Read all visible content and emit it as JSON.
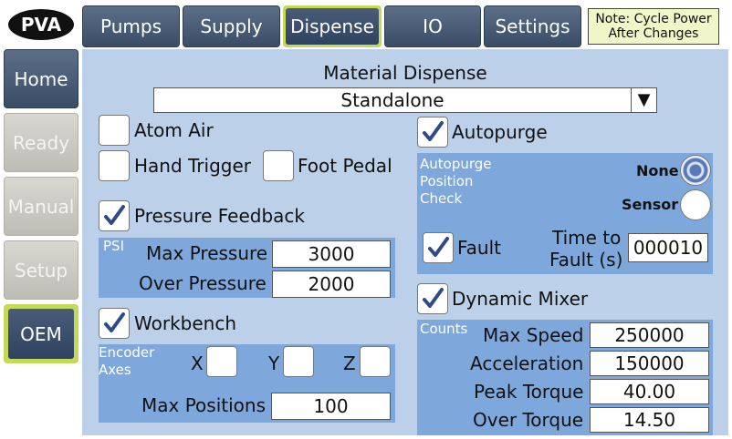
{
  "logo": {
    "text": "PVA"
  },
  "sidebar": {
    "items": [
      {
        "label": "Home",
        "state": "active"
      },
      {
        "label": "Ready",
        "state": "disabled"
      },
      {
        "label": "Manual",
        "state": "disabled"
      },
      {
        "label": "Setup",
        "state": "disabled"
      },
      {
        "label": "OEM",
        "state": "selected"
      }
    ]
  },
  "tabs": [
    {
      "label": "Pumps"
    },
    {
      "label": "Supply"
    },
    {
      "label": "Dispense",
      "selected": true
    },
    {
      "label": "IO"
    },
    {
      "label": "Settings"
    }
  ],
  "note": {
    "line1": "Note: Cycle Power",
    "line2": "After Changes"
  },
  "main": {
    "title": "Material Dispense",
    "mode_select": {
      "value": "Standalone",
      "arrow": "▼"
    },
    "atom_air": {
      "label": "Atom Air",
      "checked": false
    },
    "hand_trigger": {
      "label": "Hand Trigger",
      "checked": false
    },
    "foot_pedal": {
      "label": "Foot Pedal",
      "checked": false
    },
    "pressure_feedback": {
      "label": "Pressure Feedback",
      "checked": true,
      "unit": "PSI",
      "max_pressure_label": "Max Pressure",
      "max_pressure": "3000",
      "over_pressure_label": "Over Pressure",
      "over_pressure": "2000"
    },
    "workbench": {
      "label": "Workbench",
      "checked": true,
      "encoder_caption_1": "Encoder",
      "encoder_caption_2": "Axes",
      "x_label": "X",
      "y_label": "Y",
      "z_label": "Z",
      "x_checked": false,
      "y_checked": false,
      "z_checked": false,
      "max_positions_label": "Max Positions",
      "max_positions": "100"
    },
    "autopurge": {
      "label": "Autopurge",
      "checked": true,
      "caption_1": "Autopurge",
      "caption_2": "Position",
      "caption_3": "Check",
      "none_label": "None",
      "sensor_label": "Sensor",
      "selected": "None",
      "fault_label": "Fault",
      "fault_checked": true,
      "time_to_fault_1": "Time to",
      "time_to_fault_2": "Fault (s)",
      "time_to_fault": "000010"
    },
    "dynamic_mixer": {
      "label": "Dynamic Mixer",
      "checked": true,
      "unit": "Counts",
      "max_speed_label": "Max Speed",
      "max_speed": "250000",
      "acceleration_label": "Acceleration",
      "acceleration": "150000",
      "peak_torque_label": "Peak Torque",
      "peak_torque": "40.00",
      "over_torque_label": "Over Torque",
      "over_torque": "14.50"
    }
  },
  "icons": {
    "check": "checkmark-icon",
    "radio": "radio-icon",
    "dropdown": "dropdown-arrow-icon"
  },
  "colors": {
    "panel": "#bcd0ea",
    "group": "#7ea8dc",
    "button": "#3a4c66",
    "highlight": "#c2d95a",
    "note": "#f0f6c8"
  }
}
